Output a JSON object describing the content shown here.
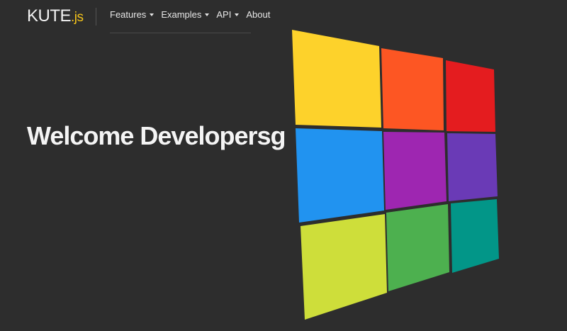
{
  "logo": {
    "name": "KUTE",
    "suffix": ".js"
  },
  "nav": {
    "items": [
      {
        "label": "Features",
        "dropdown": true
      },
      {
        "label": "Examples",
        "dropdown": true
      },
      {
        "label": "API",
        "dropdown": true
      },
      {
        "label": "About",
        "dropdown": false
      }
    ]
  },
  "hero": {
    "headline": "Welcome Developersg"
  },
  "tiles": {
    "colors": [
      "#fdd22b",
      "#fd5623",
      "#e41c1f",
      "#2193f0",
      "#9e26b1",
      "#6a3ab6",
      "#cede3a",
      "#4db04f",
      "#029688"
    ]
  }
}
